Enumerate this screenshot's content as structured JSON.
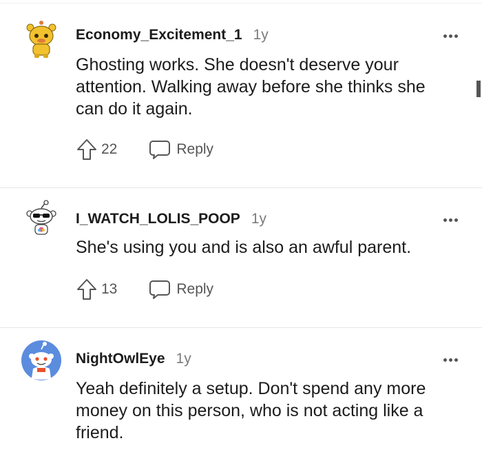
{
  "comments": [
    {
      "username": "Economy_Excitement_1",
      "age": "1y",
      "avatar": "yellow-snoo-avatar",
      "body": [
        "Ghosting works. She doesn't deserve your",
        "attention. Walking away before she thinks she",
        "can do it again."
      ],
      "votes": "22",
      "reply_label": "Reply"
    },
    {
      "username": "I_WATCH_LOLIS_POOP",
      "age": "1y",
      "avatar": "sunglasses-snoo-avatar",
      "body": [
        "She's using you and is also an awful parent."
      ],
      "votes": "13",
      "reply_label": "Reply"
    },
    {
      "username": "NightOwlEye",
      "age": "1y",
      "avatar": "blue-snoo-avatar",
      "body": [
        "Yeah definitely a setup. Don't spend any more",
        "money on this person, who is not acting like a",
        "friend."
      ]
    }
  ],
  "icons": {
    "more": "more-options-icon",
    "upvote": "upvote-arrow-icon",
    "reply": "reply-bubble-icon"
  },
  "colors": {
    "text": "#1c1c1c",
    "muted": "#7c7c7c",
    "icon": "#555555",
    "divider": "#e5e7e9",
    "avatar_blue": "#5b8cde",
    "avatar_yellow": "#f2c12e"
  }
}
